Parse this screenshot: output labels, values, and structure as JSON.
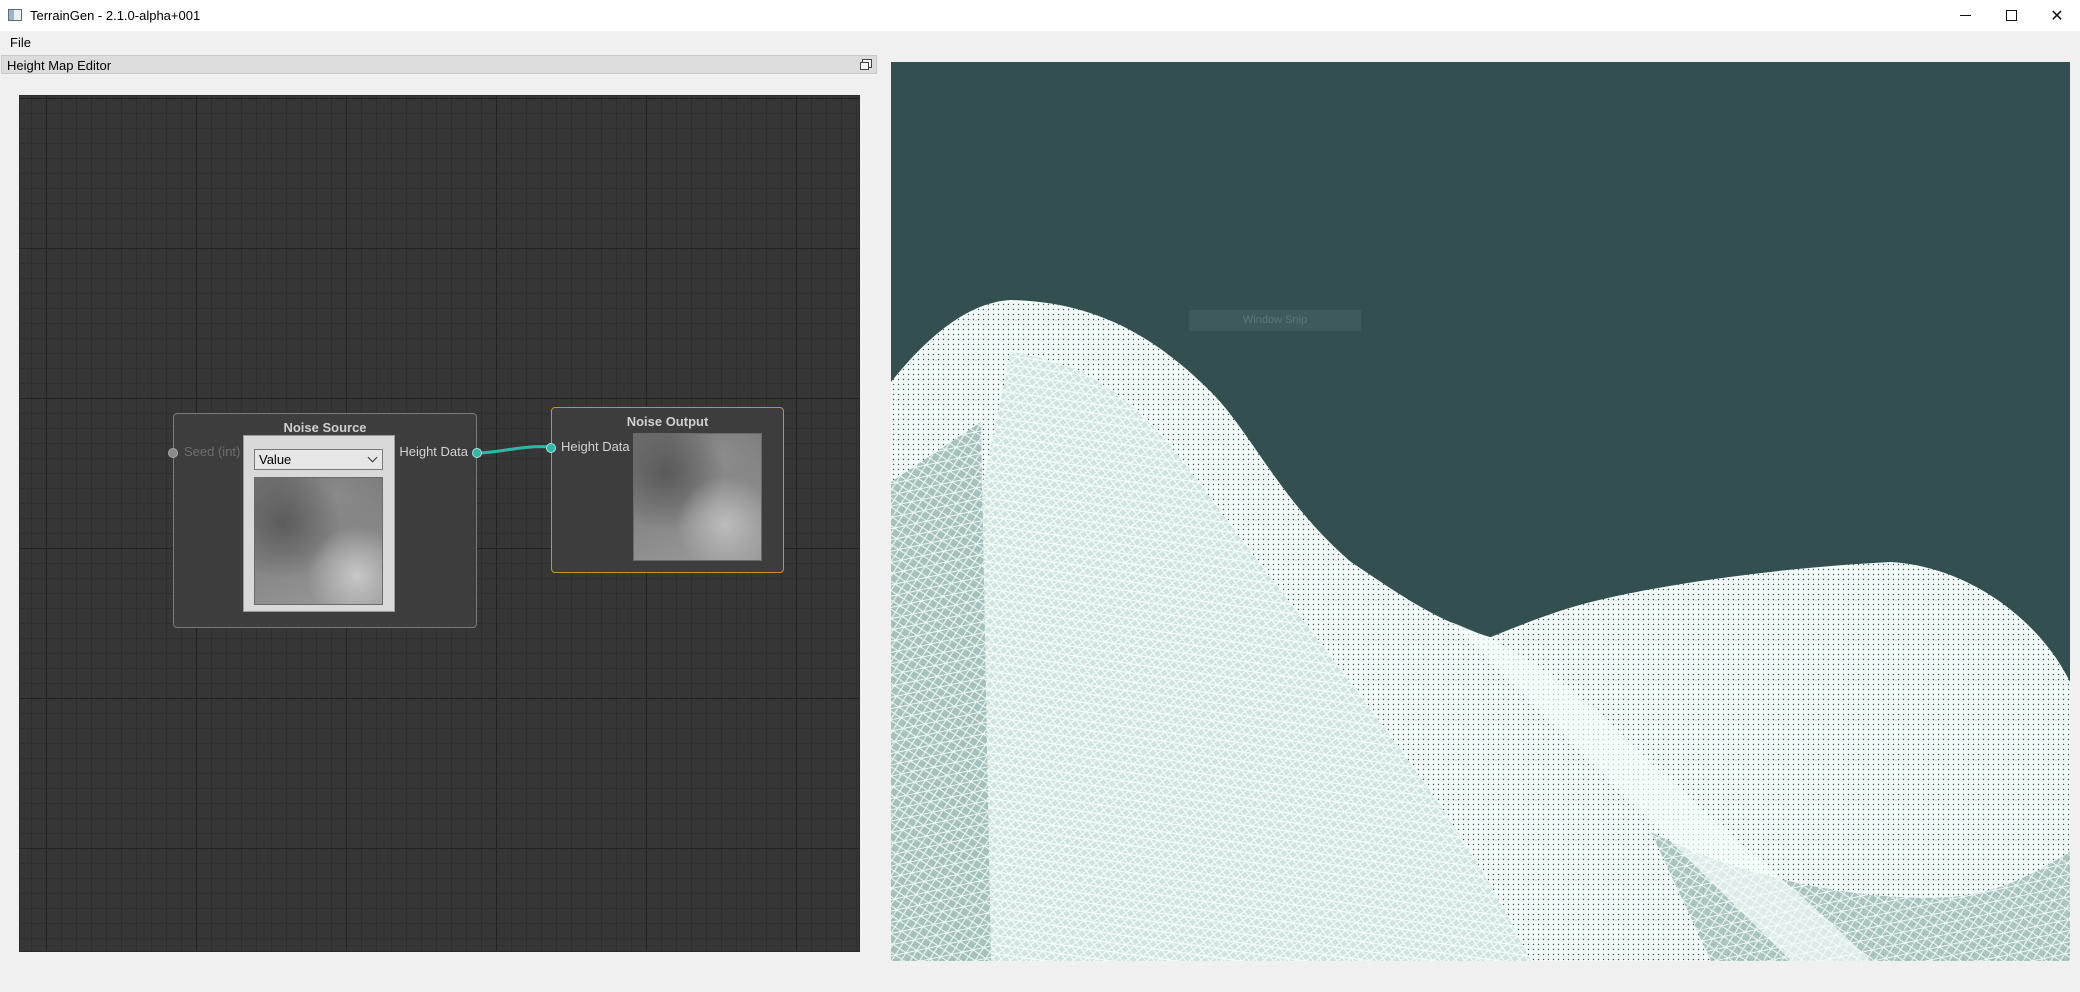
{
  "window": {
    "title": "TerrainGen - 2.1.0-alpha+001",
    "controls": {
      "minimize": "–",
      "maximize": "□",
      "close": "✕"
    }
  },
  "menubar": {
    "items": [
      {
        "label": "File"
      }
    ]
  },
  "dock": {
    "title": "Height Map Editor"
  },
  "node_editor": {
    "nodes": {
      "noise_source": {
        "title": "Noise Source",
        "input_label": "Seed (int)",
        "output_label": "Height Data",
        "dropdown_value": "Value"
      },
      "noise_output": {
        "title": "Noise Output",
        "input_label": "Height Data"
      }
    }
  },
  "viewport": {
    "overlay_text": "Window Snip",
    "background_color": "#334f4f",
    "mesh_color": "#f2fbf8"
  },
  "colors": {
    "accent_port": "#2fb7a7",
    "selected_border": "#c8932f",
    "canvas_bg": "#363636"
  }
}
